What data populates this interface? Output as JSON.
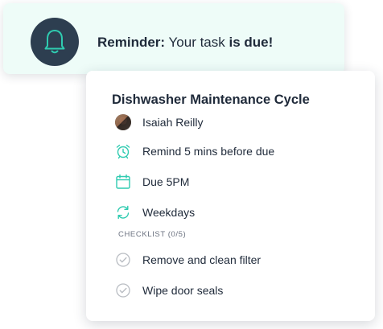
{
  "toast": {
    "prefix": "Reminder:",
    "middle": "Your task",
    "suffix": "is due!"
  },
  "card": {
    "title": "Dishwasher Maintenance Cycle",
    "assignee": "Isaiah Reilly",
    "reminder": "Remind 5 mins before due",
    "due": "Due 5PM",
    "repeat": "Weekdays",
    "checklist_header": "CHECKLIST (0/5)",
    "checklist_items": [
      "Remove and clean filter",
      "Wipe door seals"
    ]
  },
  "colors": {
    "accent": "#2fcbb0",
    "bell_bg": "#2d3e50",
    "toast_bg": "#eefcf8",
    "check_gray": "#b8bcc2"
  },
  "icons": {
    "bell": "bell-icon",
    "alarm": "alarm-clock-icon",
    "calendar": "calendar-icon",
    "repeat": "repeat-icon",
    "check": "check-circle-icon"
  }
}
